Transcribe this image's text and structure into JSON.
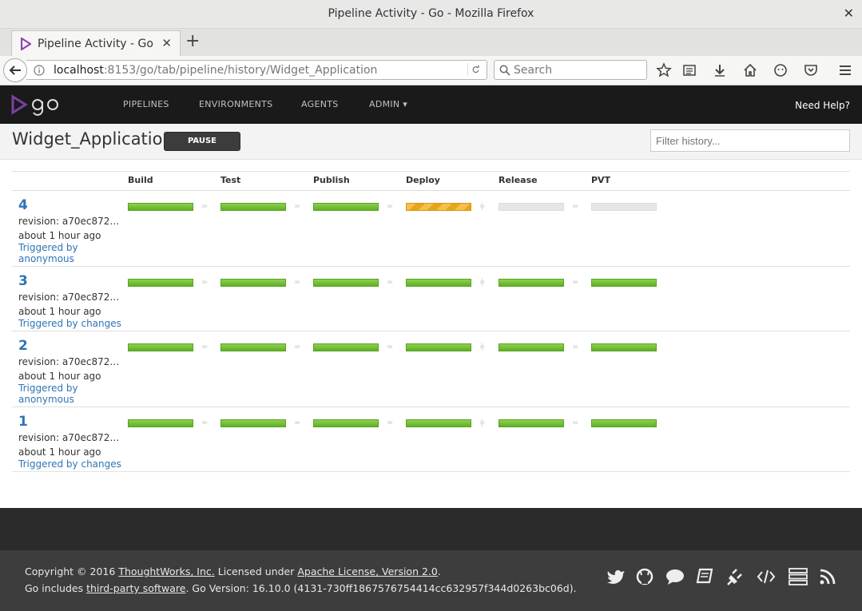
{
  "window": {
    "title": "Pipeline Activity - Go - Mozilla Firefox"
  },
  "browser": {
    "tab_title": "Pipeline Activity - Go",
    "url_host": "localhost",
    "url_rest": ":8153/go/tab/pipeline/history/Widget_Application",
    "search_placeholder": "Search"
  },
  "go_header": {
    "nav": [
      "PIPELINES",
      "ENVIRONMENTS",
      "AGENTS",
      "ADMIN"
    ],
    "help": "Need Help?"
  },
  "page": {
    "pipeline_name": "Widget_Application",
    "pause_label": "PAUSE",
    "filter_placeholder": "Filter history..."
  },
  "stages": [
    "Build",
    "Test",
    "Publish",
    "Deploy",
    "Release",
    "PVT"
  ],
  "runs": [
    {
      "number": "4",
      "revision": "revision: a70ec872…",
      "time": "about 1 hour ago",
      "trigger": "Triggered by anonymous",
      "statuses": [
        "passed",
        "passed",
        "passed",
        "building",
        "none",
        "none"
      ]
    },
    {
      "number": "3",
      "revision": "revision: a70ec872…",
      "time": "about 1 hour ago",
      "trigger": "Triggered by changes",
      "statuses": [
        "passed",
        "passed",
        "passed",
        "passed",
        "passed",
        "passed"
      ]
    },
    {
      "number": "2",
      "revision": "revision: a70ec872…",
      "time": "about 1 hour ago",
      "trigger": "Triggered by anonymous",
      "statuses": [
        "passed",
        "passed",
        "passed",
        "passed",
        "passed",
        "passed"
      ]
    },
    {
      "number": "1",
      "revision": "revision: a70ec872…",
      "time": "about 1 hour ago",
      "trigger": "Triggered by changes",
      "statuses": [
        "passed",
        "passed",
        "passed",
        "passed",
        "passed",
        "passed"
      ]
    }
  ],
  "footer": {
    "copyright_prefix": "Copyright © 2016 ",
    "company": "ThoughtWorks, Inc.",
    "licensed": " Licensed under ",
    "license": "Apache License, Version 2.0",
    "period": ".",
    "includes_prefix": "Go includes ",
    "third_party": "third-party software",
    "version": ". Go Version: 16.10.0 (4131-730ff1867576754414cc632957f344d0263bc06d)."
  },
  "colors": {
    "passed": "#5fb027",
    "building": "#f5c04a",
    "none": "#e6e6e6",
    "link": "#2e74b5"
  }
}
